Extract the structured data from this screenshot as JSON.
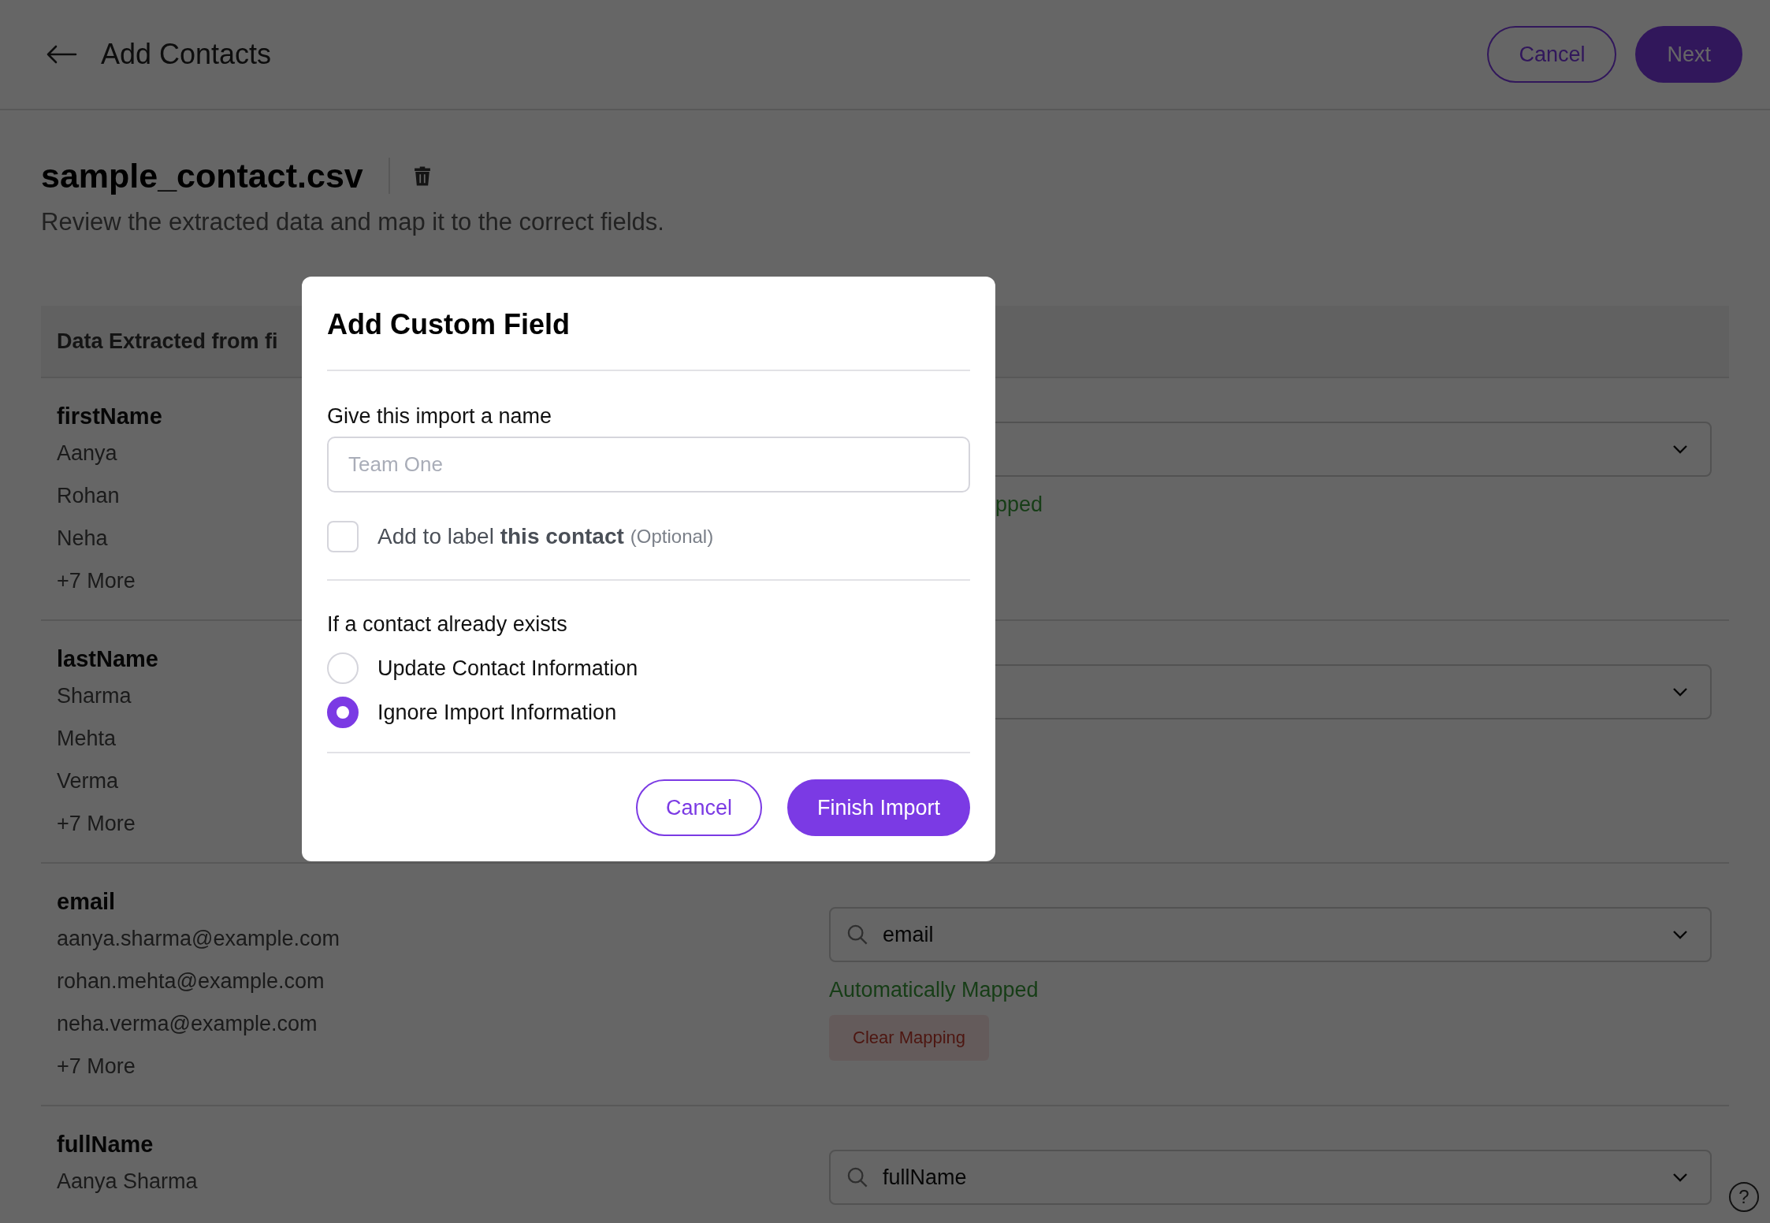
{
  "header": {
    "title": "Add Contacts",
    "buttons": [
      {
        "label": "Cancel",
        "kind": "outline"
      },
      {
        "label": "Next",
        "kind": "primary"
      }
    ]
  },
  "file": {
    "name": "sample_contact.csv",
    "subtitle": "Review the extracted data and map it to the correct fields."
  },
  "table": {
    "header": "Data Extracted from fi",
    "rows": [
      {
        "field": "firstName",
        "values": [
          "Aanya",
          "Rohan",
          "Neha"
        ],
        "more": "+7 More",
        "mapping": {
          "status": "pped"
        }
      },
      {
        "field": "lastName",
        "values": [
          "Sharma",
          "Mehta",
          "Verma"
        ],
        "more": "+7 More",
        "mapping": {}
      },
      {
        "field": "email",
        "values": [
          "aanya.sharma@example.com",
          "rohan.mehta@example.com",
          "neha.verma@example.com"
        ],
        "more": "+7 More",
        "mapping": {
          "value": "email",
          "status": "Automatically Mapped",
          "action": "Clear Mapping"
        }
      },
      {
        "field": "fullName",
        "values": [
          "Aanya Sharma"
        ],
        "mapping": {
          "value": "fullName"
        }
      }
    ]
  },
  "help": "?",
  "modal": {
    "title": "Add Custom Field",
    "name_label": "Give this import a name",
    "placeholder": "Team One",
    "checkbox": {
      "checked": false,
      "text": "Add to label **this contact**",
      "hint": "(Optional)"
    },
    "exists_label": "If a contact already exists",
    "options": [
      {
        "label": "Update Contact Information",
        "selected": false
      },
      {
        "label": "Ignore Import Information",
        "selected": true
      }
    ],
    "buttons": [
      {
        "label": "Cancel",
        "kind": "outline"
      },
      {
        "label": "Finish Import",
        "kind": "primary"
      }
    ]
  }
}
